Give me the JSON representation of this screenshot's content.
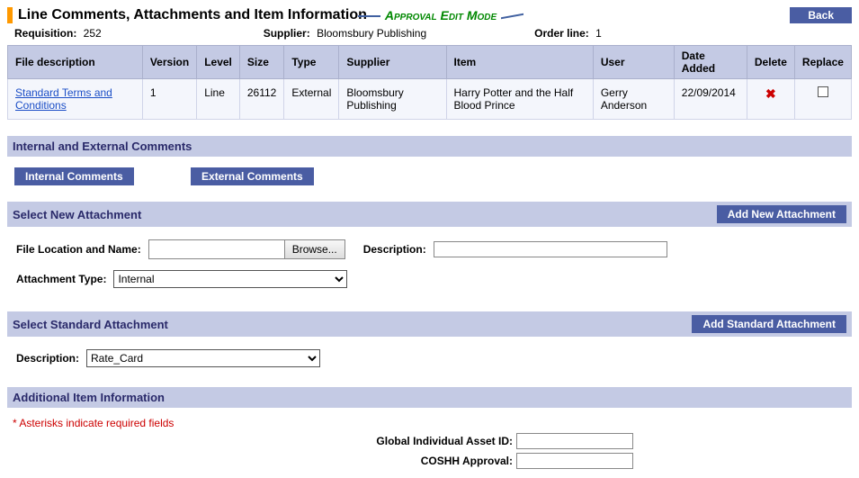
{
  "header": {
    "title": "Line Comments, Attachments and Item Information",
    "mode": "Approval Edit Mode",
    "back": "Back"
  },
  "meta": {
    "requisition_label": "Requisition:",
    "requisition_value": "252",
    "supplier_label": "Supplier:",
    "supplier_value": "Bloomsbury Publishing",
    "orderline_label": "Order line:",
    "orderline_value": "1"
  },
  "table": {
    "headers": {
      "file_desc": "File description",
      "version": "Version",
      "level": "Level",
      "size": "Size",
      "type": "Type",
      "supplier": "Supplier",
      "item": "Item",
      "user": "User",
      "date_added": "Date Added",
      "delete": "Delete",
      "replace": "Replace"
    },
    "row": {
      "file_desc": "Standard Terms and Conditions",
      "version": "1",
      "level": "Line",
      "size": "26112",
      "type": "External",
      "supplier": "Bloomsbury Publishing",
      "item": "Harry Potter and the Half Blood Prince",
      "user": "Gerry Anderson",
      "date_added": "22/09/2014"
    }
  },
  "comments": {
    "section": "Internal and External Comments",
    "internal_btn": "Internal Comments",
    "external_btn": "External Comments"
  },
  "new_attach": {
    "section": "Select New Attachment",
    "add_btn": "Add New Attachment",
    "file_label": "File Location and Name:",
    "browse": "Browse...",
    "desc_label": "Description:",
    "type_label": "Attachment Type:",
    "type_value": "Internal"
  },
  "std_attach": {
    "section": "Select Standard Attachment",
    "add_btn": "Add Standard Attachment",
    "desc_label": "Description:",
    "desc_value": "Rate_Card"
  },
  "additional": {
    "section": "Additional Item Information",
    "note": "* Asterisks indicate required fields",
    "global_id_label": "Global Individual Asset ID:",
    "coshh_label": "COSHH Approval:"
  }
}
